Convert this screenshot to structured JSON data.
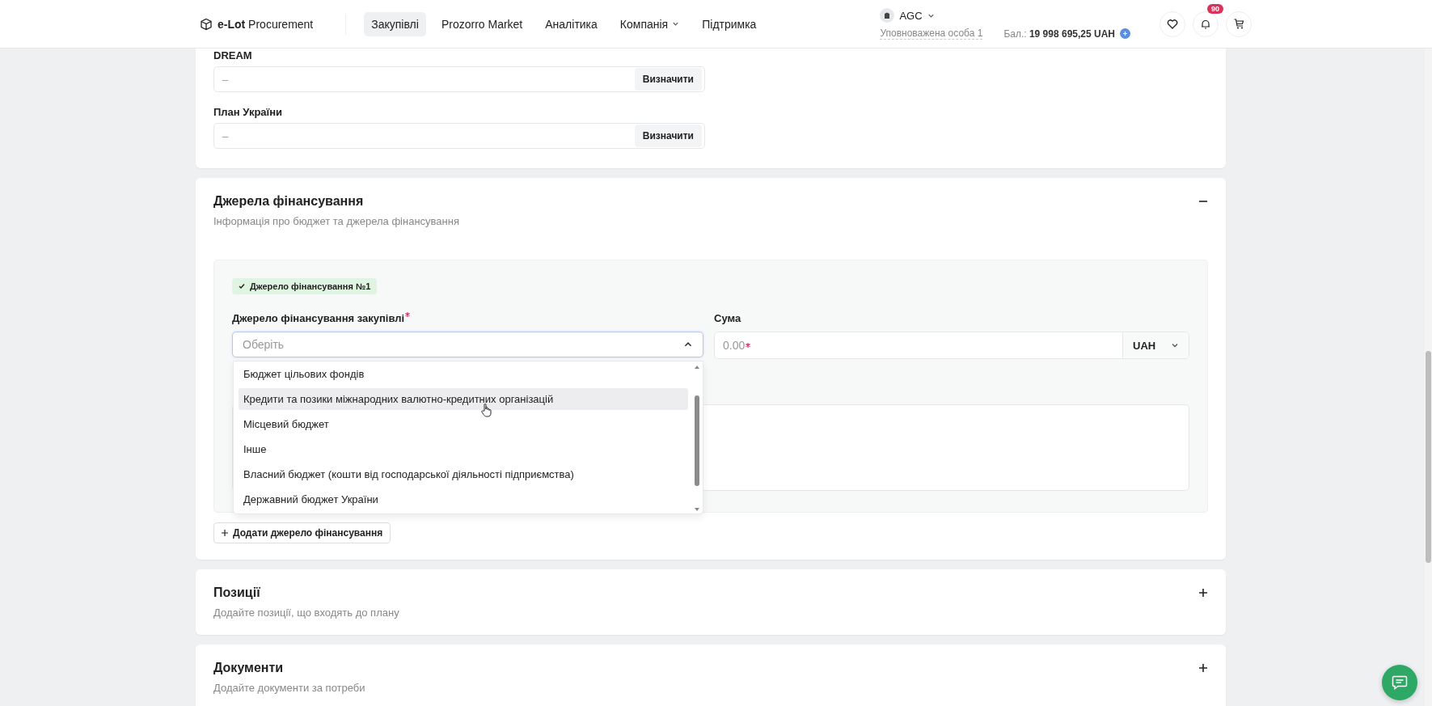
{
  "header": {
    "logo": {
      "brand_bold": "e-Lot",
      "brand_rest": "Procurement"
    },
    "nav": [
      {
        "label": "Закупівлі",
        "selected": true,
        "has_menu": false
      },
      {
        "label": "Prozorro Market",
        "selected": false,
        "has_menu": false
      },
      {
        "label": "Аналітика",
        "selected": false,
        "has_menu": false
      },
      {
        "label": "Компанія",
        "selected": false,
        "has_menu": true
      },
      {
        "label": "Підтримка",
        "selected": false,
        "has_menu": false
      }
    ],
    "account": {
      "org": "AGC",
      "role": "Уповноважена особа 1",
      "balance_label": "Бал.:",
      "balance": "19 998 695,25 UAH"
    },
    "notifications_count": "90"
  },
  "classification_card": {
    "fields": [
      {
        "label": "DREAM",
        "placeholder": "–",
        "button": "Визначити"
      },
      {
        "label": "План України",
        "placeholder": "–",
        "button": "Визначити"
      }
    ]
  },
  "funding_section": {
    "title": "Джерела фінансування",
    "subtitle": "Інформація про бюджет та джерела фінансування",
    "expanded": true,
    "source": {
      "badge": "Джерело фінансування №1",
      "source_label": "Джерело фінансування закупівлі",
      "source_required": true,
      "source_placeholder": "Оберіть",
      "amount_label": "Сума",
      "amount_placeholder": "0.00",
      "amount_required": true,
      "currency": "UAH",
      "dropdown_open": true,
      "options": [
        {
          "label": "Бюджет цільових фондів",
          "hovered": false
        },
        {
          "label": "Кредити та позики міжнародних валютно-кредитних організацій",
          "hovered": true
        },
        {
          "label": "Місцевий бюджет",
          "hovered": false
        },
        {
          "label": "Інше",
          "hovered": false
        },
        {
          "label": "Власний бюджет (кошти від господарської діяльності підприємства)",
          "hovered": false
        },
        {
          "label": "Державний бюджет України",
          "hovered": false
        }
      ]
    },
    "add_button": "Додати джерело фінансування"
  },
  "sections": [
    {
      "title": "Позиції",
      "subtitle": "Додайте позиції, що входять до плану",
      "expanded": false
    },
    {
      "title": "Документи",
      "subtitle": "Додайте документи за потреби",
      "expanded": false
    }
  ]
}
